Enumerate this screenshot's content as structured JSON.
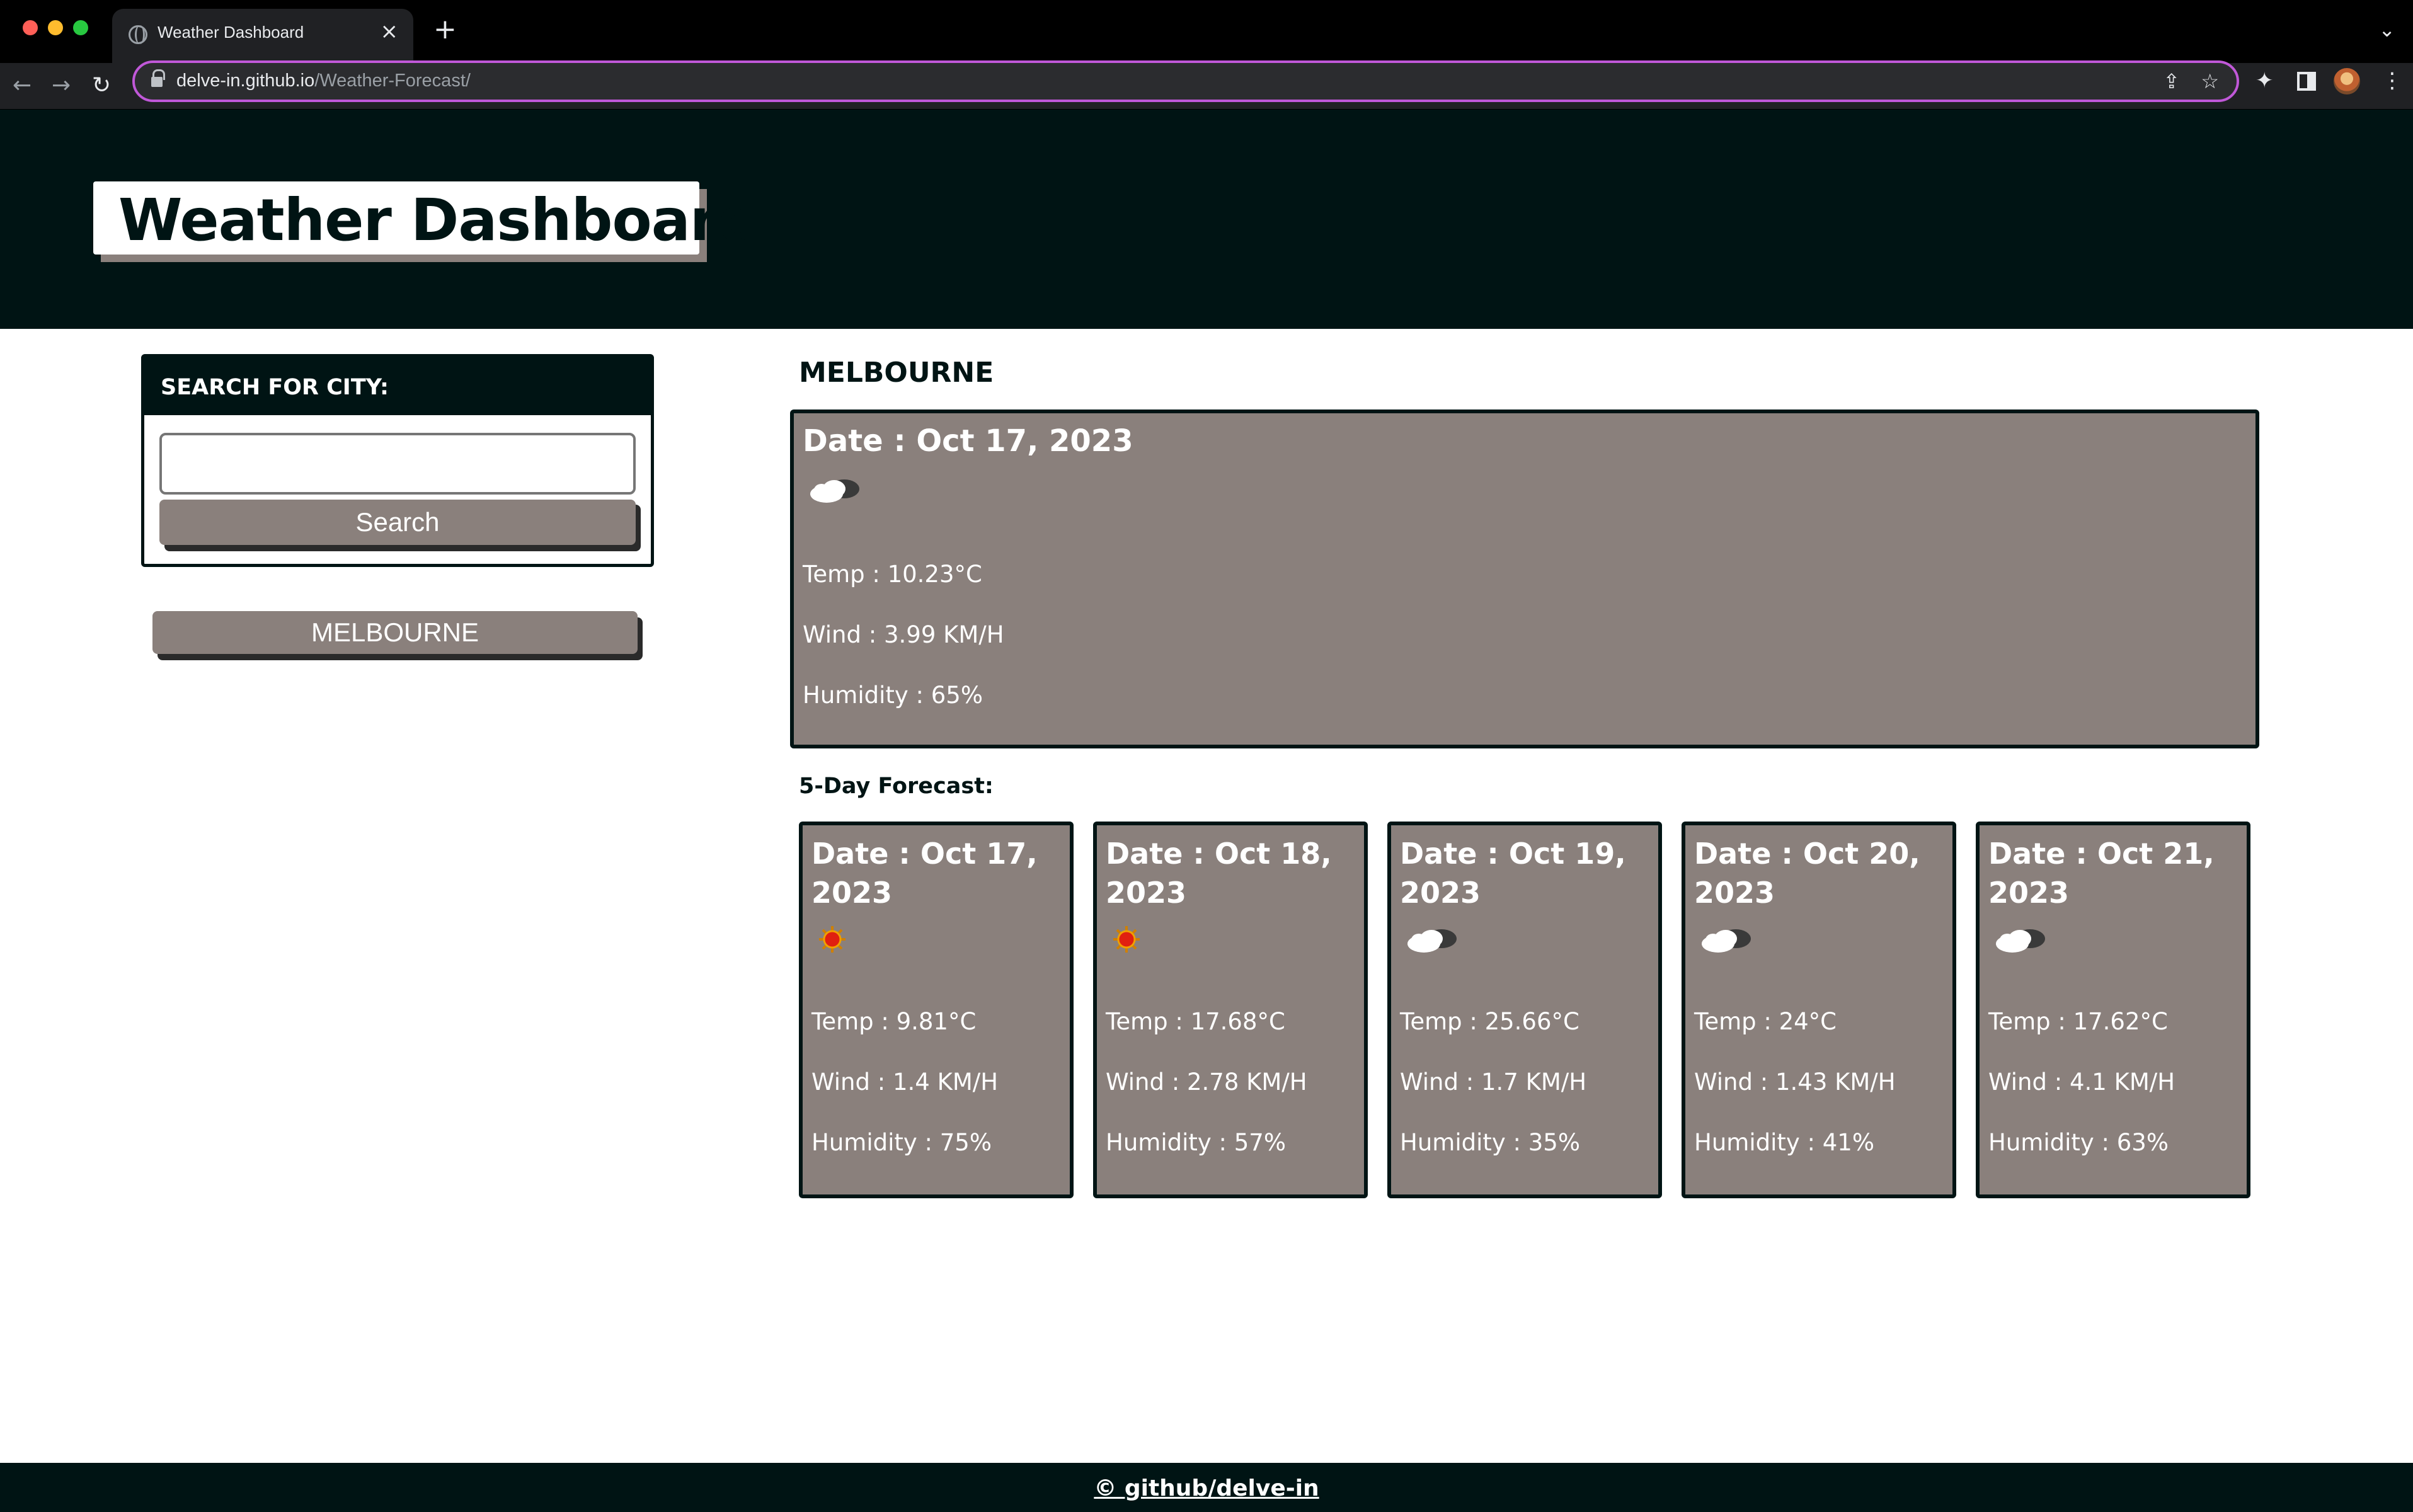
{
  "browser": {
    "tab_title": "Weather Dashboard",
    "url_host": "delve-in.github.io",
    "url_path": "/Weather-Forecast/"
  },
  "header": {
    "title": "Weather Dashboard"
  },
  "search": {
    "heading": "SEARCH FOR CITY:",
    "input_value": "",
    "button_label": "Search"
  },
  "history": [
    {
      "label": "MELBOURNE"
    }
  ],
  "current": {
    "city": "MELBOURNE",
    "date": "Date : Oct 17, 2023",
    "icon": "cloud-icon",
    "temp": "Temp : 10.23°C",
    "wind": "Wind : 3.99 KM/H",
    "humidity": "Humidity : 65%"
  },
  "forecast": {
    "title": "5-Day Forecast:",
    "days": [
      {
        "date": "Date : Oct 17, 2023",
        "icon": "sun-icon",
        "temp": "Temp : 9.81°C",
        "wind": "Wind : 1.4 KM/H",
        "humidity": "Humidity : 75%"
      },
      {
        "date": "Date : Oct 18, 2023",
        "icon": "sun-icon",
        "temp": "Temp : 17.68°C",
        "wind": "Wind : 2.78 KM/H",
        "humidity": "Humidity : 57%"
      },
      {
        "date": "Date : Oct 19, 2023",
        "icon": "cloud-icon",
        "temp": "Temp : 25.66°C",
        "wind": "Wind : 1.7 KM/H",
        "humidity": "Humidity : 35%"
      },
      {
        "date": "Date : Oct 20, 2023",
        "icon": "cloud-icon",
        "temp": "Temp : 24°C",
        "wind": "Wind : 1.43 KM/H",
        "humidity": "Humidity : 41%"
      },
      {
        "date": "Date : Oct 21, 2023",
        "icon": "cloud-icon",
        "temp": "Temp : 17.62°C",
        "wind": "Wind : 4.1 KM/H",
        "humidity": "Humidity : 63%"
      }
    ]
  },
  "footer": {
    "link": "© github/delve-in"
  },
  "colors": {
    "dark": "#001414",
    "card": "#8a807c",
    "accent_focus": "#c058d8"
  }
}
